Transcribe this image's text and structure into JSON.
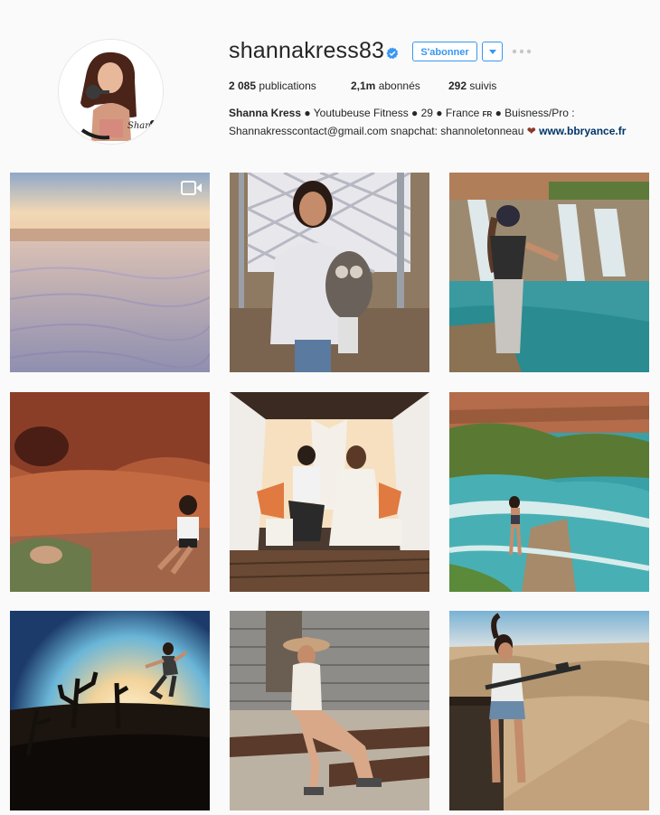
{
  "profile": {
    "username": "shannakress83",
    "follow_label": "S'abonner",
    "avatar_signature": "Shanna"
  },
  "stats": {
    "posts_count": "2 085",
    "posts_label": "publications",
    "followers_count": "2,1m",
    "followers_label": "abonnés",
    "following_count": "292",
    "following_label": "suivis"
  },
  "bio": {
    "name": "Shanna Kress",
    "line1_rest": " ● Youtubeuse Fitness ● 29 ● France ",
    "flag_code": "FR",
    "line1_end": " ● Buisness/Pro :",
    "line2": "Shannakresscontact@gmail.com snapchat: shannoletonneau ",
    "website": "www.bbryance.fr"
  },
  "colors": {
    "accent": "#3897f0",
    "link": "#003569",
    "text": "#262626",
    "background": "#fafafa"
  },
  "posts": [
    {
      "id": 1,
      "scene": "desert-sand-dunes",
      "has_video": true
    },
    {
      "id": 2,
      "scene": "woman-holding-owl-plush"
    },
    {
      "id": 3,
      "scene": "woman-at-waterfall"
    },
    {
      "id": 4,
      "scene": "woman-on-red-rocks"
    },
    {
      "id": 5,
      "scene": "couple-dining-in-gazebo"
    },
    {
      "id": 6,
      "scene": "woman-at-turquoise-river"
    },
    {
      "id": 7,
      "scene": "woman-jumping-at-sunset"
    },
    {
      "id": 8,
      "scene": "woman-in-cowboy-hat-on-bench"
    },
    {
      "id": 9,
      "scene": "woman-with-rifle-in-desert"
    }
  ]
}
